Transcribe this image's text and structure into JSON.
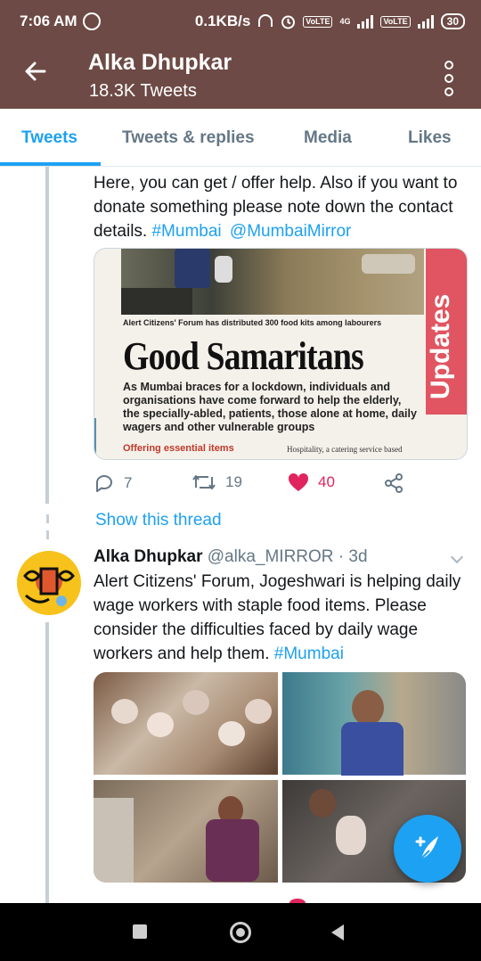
{
  "status_bar": {
    "time": "7:06 AM",
    "net_speed": "0.1KB/s",
    "sim1_label": "4G",
    "lte_label": "VoLTE",
    "battery": "30"
  },
  "app_bar": {
    "back_icon": "arrow-left-icon",
    "title": "Alka Dhupkar",
    "subtitle": "18.3K Tweets",
    "menu_icon": "more-vert-icon"
  },
  "tabs": [
    {
      "label": "Tweets",
      "active": true
    },
    {
      "label": "Tweets & replies",
      "active": false
    },
    {
      "label": "Media",
      "active": false
    },
    {
      "label": "Likes",
      "active": false
    }
  ],
  "tweet1": {
    "text_plain": "Here, you can get / offer help. Also if you want to donate something please note down the contact details.",
    "hashtag": "#Mumbai",
    "mention": "@MumbaiMirror",
    "card": {
      "tab_label": "Updates",
      "caption": "Alert Citizens' Forum  has distributed 300 food kits among labourers",
      "headline": "Good Samaritans",
      "body": "As Mumbai braces for a lockdown, individuals and organisations have come forward to help the elderly, the specially-abled, patients, those alone at home, daily wagers and other vulnerable groups",
      "offering": "Offering essential items",
      "hospitality": "Hospitality, a catering service based"
    },
    "actions": {
      "replies": "7",
      "retweets": "19",
      "likes": "40",
      "liked_color": "#e0245e"
    },
    "show_thread": "Show this thread"
  },
  "tweet2": {
    "name": "Alka Dhupkar",
    "handle": "@alka_MIRROR",
    "separator": "·",
    "age": "3d",
    "text_plain": "Alert Citizens' Forum, Jogeshwari is helping daily wage workers with staple food items. Please consider the difficulties faced by daily wage workers and help them.",
    "hashtag": "#Mumbai"
  },
  "colors": {
    "app_bar": "#6d4a45",
    "accent": "#1da1f2",
    "secondary_text": "#657786"
  },
  "fab_icon": "compose-tweet-icon",
  "nav_bar": [
    "stop-square-icon",
    "home-circle-icon",
    "back-triangle-icon"
  ]
}
